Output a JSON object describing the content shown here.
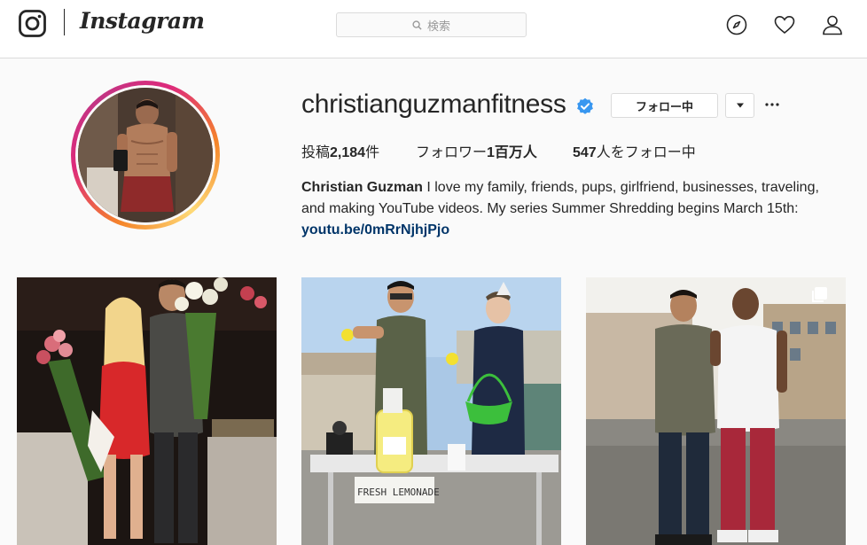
{
  "header": {
    "wordmark": "Instagram",
    "search_placeholder": "検索",
    "nav_icons": [
      "explore-compass-icon",
      "activity-heart-icon",
      "profile-person-icon"
    ]
  },
  "profile": {
    "username": "christianguzmanfitness",
    "verified": true,
    "follow_label": "フォロー中",
    "stats": {
      "posts_prefix": "投稿",
      "posts_count": "2,184",
      "posts_suffix": "件",
      "followers_prefix": "フォロワー",
      "followers_count": "1百万人",
      "following_count": "547",
      "following_suffix": "人をフォロー中"
    },
    "bio": {
      "name": "Christian Guzman",
      "text": " I love my family, friends, pups, girlfriend, businesses, traveling, and making YouTube videos. My series Summer Shredding begins March 15th: ",
      "link": "youtu.be/0mRrNjhjPjo"
    }
  },
  "posts": [
    {
      "index": 1,
      "multi": false
    },
    {
      "index": 2,
      "multi": false
    },
    {
      "index": 3,
      "multi": true
    }
  ],
  "colors": {
    "verified_blue": "#3897f0",
    "link_blue": "#003569",
    "border": "#dbdbdb",
    "background": "#fafafa"
  },
  "signage": {
    "post2_sign": "FRESH LEMONADE",
    "post2_bottle": "Simply Lemonade"
  }
}
